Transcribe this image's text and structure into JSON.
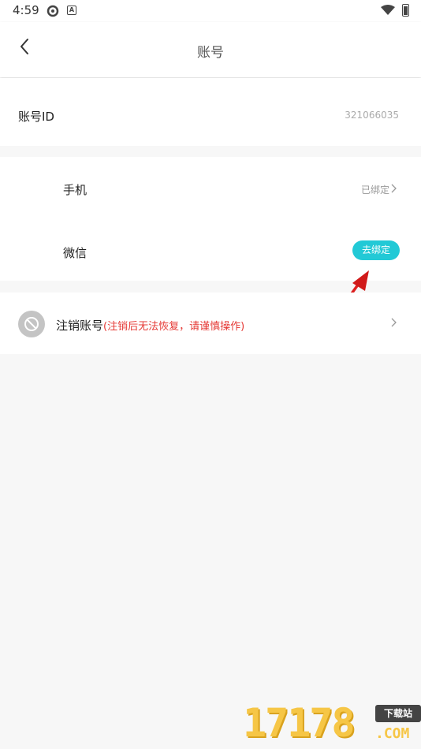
{
  "status_bar": {
    "time": "4:59",
    "icons": [
      "sync-icon",
      "a-badge-icon",
      "wifi-icon",
      "battery-icon"
    ],
    "badge_letter": "A"
  },
  "header": {
    "title": "账号",
    "back_icon": "chevron-left-icon"
  },
  "account_id": {
    "label": "账号ID",
    "value": "321066035"
  },
  "bindings": {
    "phone": {
      "label": "手机",
      "status": "已绑定"
    },
    "wechat": {
      "label": "微信",
      "button_label": "去绑定"
    }
  },
  "cancel_account": {
    "label": "注销账号",
    "warning": "(注销后无法恢复，请谨慎操作)",
    "icon": "prohibited-icon"
  },
  "watermark": {
    "digits": "17178",
    "badge": "下载站",
    "suffix": ".COM"
  },
  "colors": {
    "accent": "#22c9d6",
    "warning": "#e53935",
    "arrow": "#d11a1a",
    "background": "#f7f7f7"
  }
}
